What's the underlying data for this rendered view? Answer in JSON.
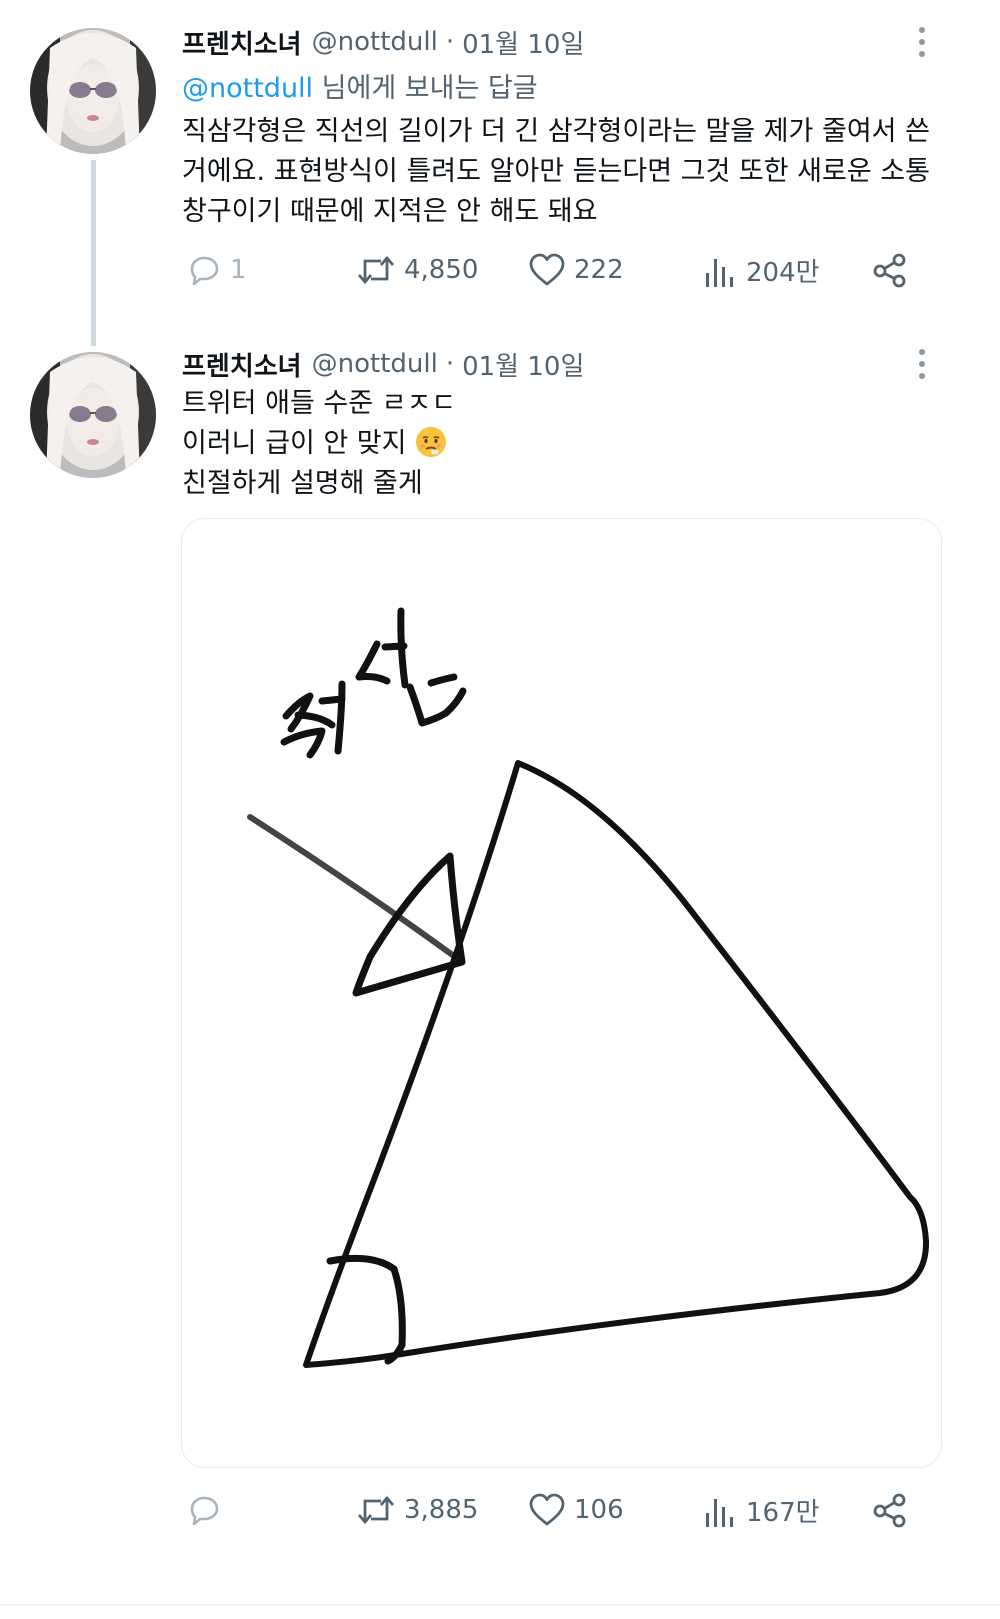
{
  "colors": {
    "accent": "#1d9bf0",
    "secondary_text": "#536471",
    "primary_text": "#0f1419",
    "thread_line": "#cfd9de"
  },
  "tweets": [
    {
      "author_name": "프렌치소녀",
      "author_handle": "@nottdull",
      "separator": "·",
      "date": "01월 10일",
      "reply_to_mention": "@nottdull",
      "reply_to_suffix": "님에게 보내는 답글",
      "body_lines": [
        "직삼각형은 직선의 길이가 더 긴 삼각형이라는 말을 제가 줄여서 쓴",
        "거에요. 표현방식이 틀려도 알아만 듣는다면 그것 또한 새로운 소통",
        "창구이기 때문에 지적은 안 해도 돼요"
      ],
      "stats": {
        "replies": "1",
        "retweets": "4,850",
        "likes": "222",
        "views": "204만"
      }
    },
    {
      "author_name": "프렌치소녀",
      "author_handle": "@nottdull",
      "separator": "·",
      "date": "01월 10일",
      "body_lines": [
        "트위터 애들 수준 ㄹㅈㄷ",
        "이러니 급이 안 맞지",
        "친절하게 설명해 줄게"
      ],
      "emoji_name": "face-with-steam-from-nose-emoji",
      "image": {
        "handwritten_label": "직선",
        "icon": "hand-drawn-triangle-sketch"
      },
      "stats": {
        "replies": "",
        "retweets": "3,885",
        "likes": "106",
        "views": "167만"
      }
    }
  ],
  "icons": {
    "reply": "reply-bubble-icon",
    "retweet": "retweet-icon",
    "like": "heart-icon",
    "views": "views-bar-chart-icon",
    "share": "share-icon",
    "more": "more-options-icon"
  }
}
